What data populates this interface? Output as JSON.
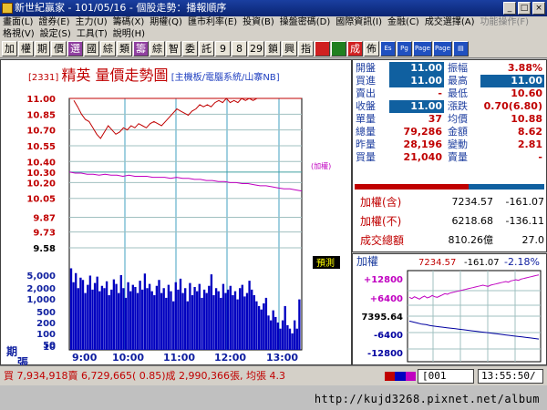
{
  "title": "新世紀贏家 - 101/05/16 - 個股走勢：播報順序",
  "menu1": [
    "畫面(L)",
    "證券(E)",
    "主力(U)",
    "籌碼(X)",
    "期權(Q)",
    "匯市利率(E)",
    "投資(B)",
    "操盤密碼(D)",
    "國際資訊(I)",
    "金融(C)",
    "成交選擇(A)",
    "功能操作(F)"
  ],
  "menu2": [
    "格視(V)",
    "設定(S)",
    "工具(T)",
    "說明(H)"
  ],
  "toolbar": [
    "加",
    "權",
    "期",
    "價",
    "選",
    "國",
    "綜",
    "類",
    "籌",
    "綜",
    "智",
    "委",
    "託",
    "9",
    "8",
    "29",
    "鎖",
    "興",
    "指",
    "",
    "",
    "成",
    "佈"
  ],
  "header": {
    "code": "[2331]",
    "name": "精英 量價走勢圖",
    "category": "[主機板/電腦系統/山寨NB]"
  },
  "price_axis": [
    "11.00",
    "10.85",
    "10.70",
    "10.55",
    "10.40",
    "10.30",
    "10.20",
    "10.05",
    "9.87",
    "9.73",
    "9.58"
  ],
  "volume_axis": [
    "5,000",
    "2,000",
    "1,000",
    "500",
    "200",
    "100",
    "50",
    "10"
  ],
  "vol_unit": [
    "期",
    "張"
  ],
  "time_axis": [
    "9:00",
    "10:00",
    "11:00",
    "12:00",
    "13:00"
  ],
  "index_label": "(加權)",
  "cursor_label": "預測",
  "quote": [
    {
      "l1": "開盤",
      "v1": "11.00",
      "b1": true,
      "l2": "振幅",
      "v2": "3.88%",
      "c2": "#c00000"
    },
    {
      "l1": "買進",
      "v1": "11.00",
      "b1": true,
      "l2": "最高",
      "v2": "11.00",
      "b2": true
    },
    {
      "l1": "賣出",
      "v1": "-",
      "l2": "最低",
      "v2": "10.60",
      "c2": "#c00000"
    },
    {
      "l1": "收盤",
      "v1": "11.00",
      "b1": true,
      "l2": "漲跌",
      "v2": "0.70(6.80)",
      "c2": "#c00000"
    },
    {
      "l1": "單量",
      "v1": "37",
      "c1": "#c00000",
      "l2": "均價",
      "v2": "10.88",
      "c2": "#c00000"
    },
    {
      "l1": "總量",
      "v1": "79,286",
      "c1": "#c00000",
      "l2": "金額",
      "v2": "8.62",
      "c2": "#c00000"
    },
    {
      "l1": "昨量",
      "v1": "28,196",
      "c1": "#c00000",
      "l2": "變動",
      "v2": "2.81",
      "c2": "#c00000"
    },
    {
      "l1": "買量",
      "v1": "21,040",
      "c1": "#c00000",
      "l2": "賣量",
      "v2": "-",
      "c2": "#c00000"
    }
  ],
  "index_rows": [
    {
      "label": "加權(含)",
      "value": "7234.57",
      "change": "-161.07"
    },
    {
      "label": "加權(不)",
      "value": "6218.68",
      "change": "-136.11"
    },
    {
      "label": "成交總額",
      "value": "810.26億",
      "change": "27.0"
    }
  ],
  "mini": {
    "label": "加權",
    "value": "7234.57",
    "change": "-161.07",
    "pct": "-2.18%",
    "axis_top": [
      "+12800",
      "+6400"
    ],
    "axis_mid": "7395.64",
    "axis_bot": [
      "-6400",
      "-12800"
    ]
  },
  "status": {
    "text": "買 7,934,918賣 6,729,665( 0.85)成 2,990,366張, 均張 4.3",
    "code": "[001",
    "time": "13:55:50/"
  },
  "url": "http://kujd3268.pixnet.net/album",
  "chart_data": {
    "type": "line",
    "price_series": [
      10.98,
      10.92,
      10.85,
      10.8,
      10.78,
      10.72,
      10.66,
      10.62,
      10.68,
      10.74,
      10.7,
      10.66,
      10.68,
      10.72,
      10.7,
      10.74,
      10.72,
      10.76,
      10.74,
      10.72,
      10.76,
      10.78,
      10.76,
      10.74,
      10.78,
      10.82,
      10.86,
      10.9,
      10.88,
      10.86,
      10.84,
      10.88,
      10.9,
      10.94,
      10.92,
      10.94,
      10.92,
      10.96,
      10.98,
      10.96,
      11.0,
      10.96,
      10.98,
      10.96,
      11.0,
      10.98,
      11.0,
      10.98,
      11.0,
      11.0
    ],
    "index_series": [
      10.3,
      10.29,
      10.29,
      10.28,
      10.28,
      10.27,
      10.28,
      10.27,
      10.27,
      10.26,
      10.27,
      10.26,
      10.26,
      10.26,
      10.25,
      10.25,
      10.25,
      10.24,
      10.25,
      10.24,
      10.24,
      10.23,
      10.23,
      10.22,
      10.22,
      10.21,
      10.21,
      10.2,
      10.2,
      10.19,
      10.19,
      10.18,
      10.17,
      10.17,
      10.16,
      10.15,
      10.14,
      10.14,
      10.13,
      10.12
    ],
    "price_range": [
      9.58,
      11.0
    ],
    "volume_series": [
      4800,
      1500,
      3200,
      900,
      2200,
      1800,
      600,
      1200,
      2600,
      800,
      1400,
      2400,
      700,
      1100,
      900,
      1600,
      500,
      800,
      1900,
      1300,
      600,
      2700,
      900,
      400,
      1500,
      700,
      1200,
      1000,
      600,
      1700,
      800,
      3100,
      900,
      1300,
      700,
      500,
      1100,
      1800,
      600,
      900,
      400,
      1200,
      700,
      300,
      1500,
      800,
      2000,
      600,
      900,
      300,
      1400,
      500,
      1000,
      700,
      1300,
      400,
      800,
      600,
      1100,
      2900,
      500,
      900,
      700,
      400,
      1300,
      600,
      800,
      1100,
      500,
      700,
      350,
      900,
      1200,
      450,
      600,
      1700,
      800,
      500,
      300,
      200,
      150,
      250,
      400,
      90,
      60,
      140,
      80,
      50,
      30,
      60,
      200,
      40,
      30,
      20,
      60,
      30,
      350
    ],
    "mini_series": [
      5200,
      4800,
      5400,
      5000,
      4600,
      5200,
      5600,
      5000,
      5300,
      5800,
      5400,
      5200,
      5600,
      6000,
      6400,
      6200,
      6600,
      6800,
      7000,
      7200,
      7400,
      7600,
      7800,
      8000,
      8200,
      8400,
      8600,
      8800,
      9000,
      9200,
      9000,
      8800,
      9200,
      9400,
      9600,
      9800,
      10000,
      10200,
      10400,
      10200,
      10600,
      10800,
      11000,
      10800,
      11200,
      11400,
      11600,
      11800,
      12000,
      12200,
      12400,
      12600
    ],
    "mini_series2": [
      -1200,
      -1600,
      -2000,
      -2400,
      -2600,
      -3000,
      -3200,
      -3400,
      -3600,
      -3800,
      -4000,
      -4200,
      -4400,
      -4600,
      -4800,
      -5000,
      -5200,
      -5400,
      -5600,
      -5800,
      -6000,
      -6200,
      -6400,
      -6600,
      -6800,
      -7000,
      -7200,
      -7400,
      -7600,
      -7800,
      -8000,
      -8200
    ],
    "colors": {
      "price": "#c00000",
      "index": "#c000c0",
      "volume": "#0000c0",
      "mini_up": "#c000c0",
      "mini_down": "#0000a0"
    }
  }
}
